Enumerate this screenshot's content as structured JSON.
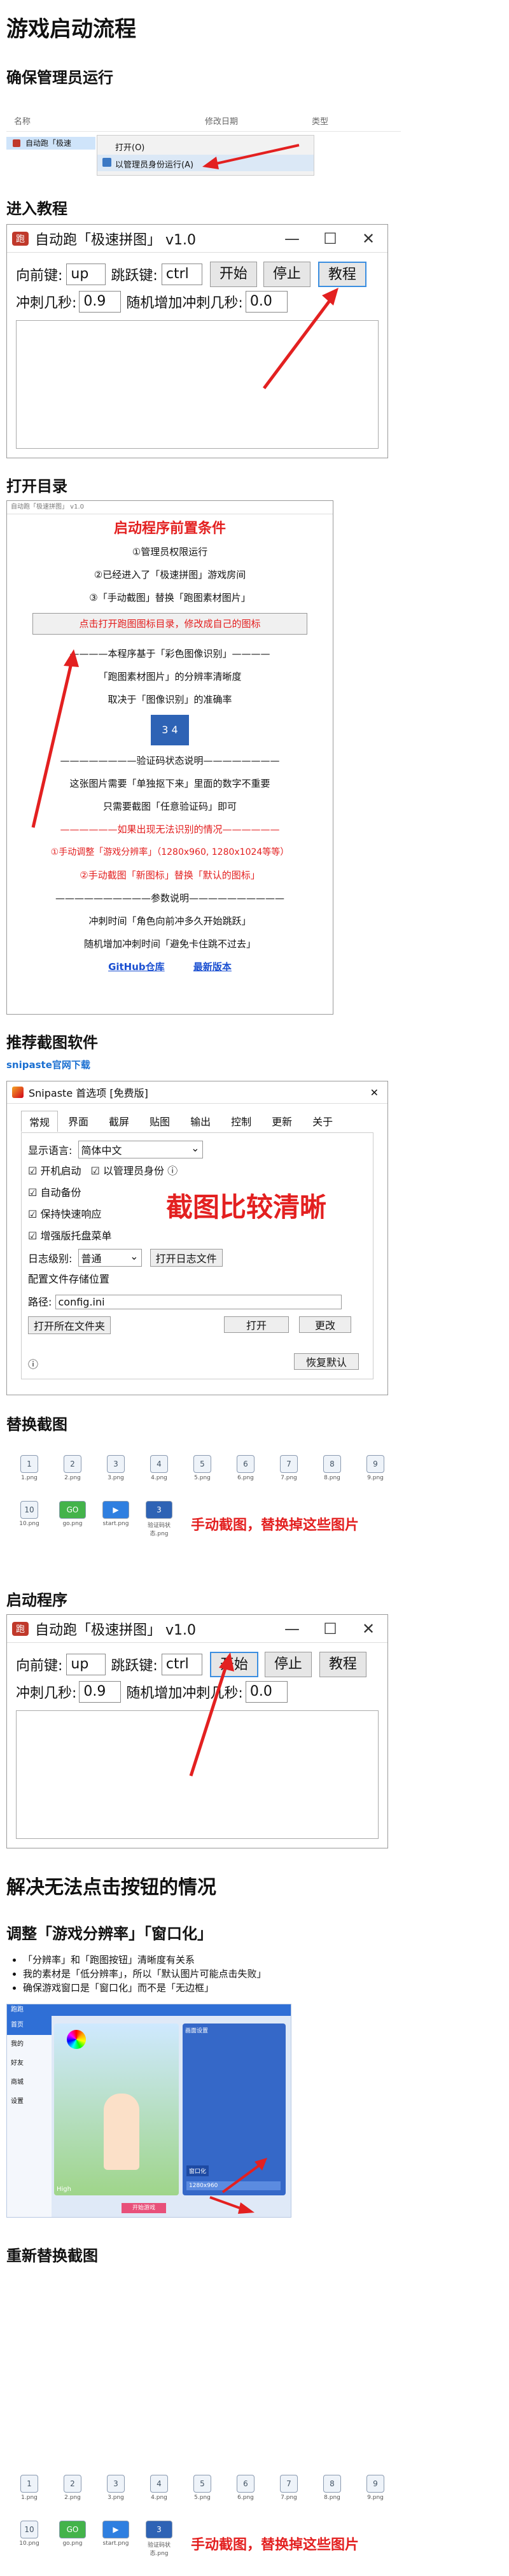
{
  "page": {
    "title": "游戏启动流程",
    "admin_title": "确保管理员运行",
    "tutorial_title": "进入教程",
    "opendir_title": "打开目录",
    "recommend_title": "推荐截图软件",
    "snipaste_link": "snipaste官网下载",
    "replace_title": "替换截图",
    "launch_title": "启动程序",
    "fix_title": "解决无法点击按钮的情况",
    "resolution_title": "调整「游戏分辨率」「窗口化」",
    "bullets": [
      "「分辨率」和「跑图按钮」清晰度有关系",
      "我的素材是「低分辨率」，所以「默认图片可能点击失败」",
      "确保游戏窗口是「窗口化」而不是「无边框」"
    ],
    "rereplace_title": "重新替换截图"
  },
  "explorer": {
    "col_name": "名称",
    "col_date": "修改日期",
    "col_type": "类型",
    "file": "自动跑「极速",
    "menu_open": "打开(O)",
    "menu_admin": "以管理员身份运行(A)"
  },
  "app": {
    "title": "自动跑「极速拼图」 v1.0",
    "forward_label": "向前键:",
    "forward_value": "up",
    "jump_label": "跳跃键:",
    "jump_value": "ctrl",
    "start_label": "开始",
    "stop_label": "停止",
    "tutorial_label": "教程",
    "dash_label": "冲刺几秒:",
    "dash_value": "0.9",
    "random_label": "随机增加冲刺几秒:",
    "random_value": "0.0"
  },
  "tutorial_window": {
    "title": "自动跑「极速拼图」 v1.0",
    "heading": "启动程序前置条件",
    "cond1": "①管理员权限运行",
    "cond2": "②已经进入了「极速拼图」游戏房间",
    "cond3": "③「手动截图」替换「跑图素材图片」",
    "open_dir_button": "点击打开跑图图标目录，修改成自己的图标",
    "sep_recognition": "本程序基于「彩色图像识别」",
    "recog1": "「跑图素材图片」的分辨率清晰度",
    "recog2": "取决于「图像识别」的准确率",
    "sep_captcha": "验证码状态说明",
    "captcha1": "这张图片需要「单独抠下来」里面的数字不重要",
    "captcha2": "只需要截图「任意验证码」即可",
    "sep_fail": "如果出现无法识别的情况",
    "fail1": "①手动调整「游戏分辨率」（1280x960, 1280x1024等等）",
    "fail2": "②手动截图「新图标」替换「默认的图标」",
    "sep_params": "参数说明",
    "param1": "冲刺时间「角色向前冲多久开始跳跃」",
    "param2": "随机增加冲刺时间「避免卡住跳不过去」",
    "github": "GitHub仓库",
    "latest": "最新版本"
  },
  "snipaste": {
    "title": "Snipaste 首选项 [免费版]",
    "tabs": [
      "常规",
      "界面",
      "截屏",
      "贴图",
      "输出",
      "控制",
      "更新",
      "关于"
    ],
    "lang_label": "显示语言:",
    "lang_value": "简体中文",
    "chk_autostart": "开机启动",
    "chk_admin": "以管理员身份",
    "chk_autobackup": "自动备份",
    "chk_keepfast": "保持快速响应",
    "chk_tray": "增强版托盘菜单",
    "log_label": "日志级别:",
    "log_value": "普通",
    "open_log": "打开日志文件",
    "config_group": "配置文件存储位置",
    "path_label": "路径:",
    "path_value": "config.ini",
    "open_btn": "打开",
    "change_btn": "更改",
    "open_folder": "打开所在文件夹",
    "restore": "恢复默认",
    "overlay": "截图比较清晰"
  },
  "replace": {
    "note": "手动截图，替换掉这些图片",
    "files_row1": [
      "1.png",
      "2.png",
      "3.png",
      "4.png",
      "5.png",
      "6.png",
      "7.png",
      "8.png",
      "9.png"
    ],
    "files_row2": [
      "10.png",
      "go.png",
      "start.png",
      "验证码状态.png"
    ]
  },
  "game": {
    "title": "跑跑",
    "tabs": [
      "首页",
      "我的",
      "好友",
      "商城",
      "设置"
    ],
    "high": "High",
    "bottom_btn": "开始游戏",
    "options": [
      "窗口化",
      "1280x960"
    ],
    "panel_header": "画面设置"
  },
  "colors": {
    "accent_red": "#e32020",
    "link_blue": "#1a6fd1",
    "game_blue": "#2f6fd6"
  }
}
